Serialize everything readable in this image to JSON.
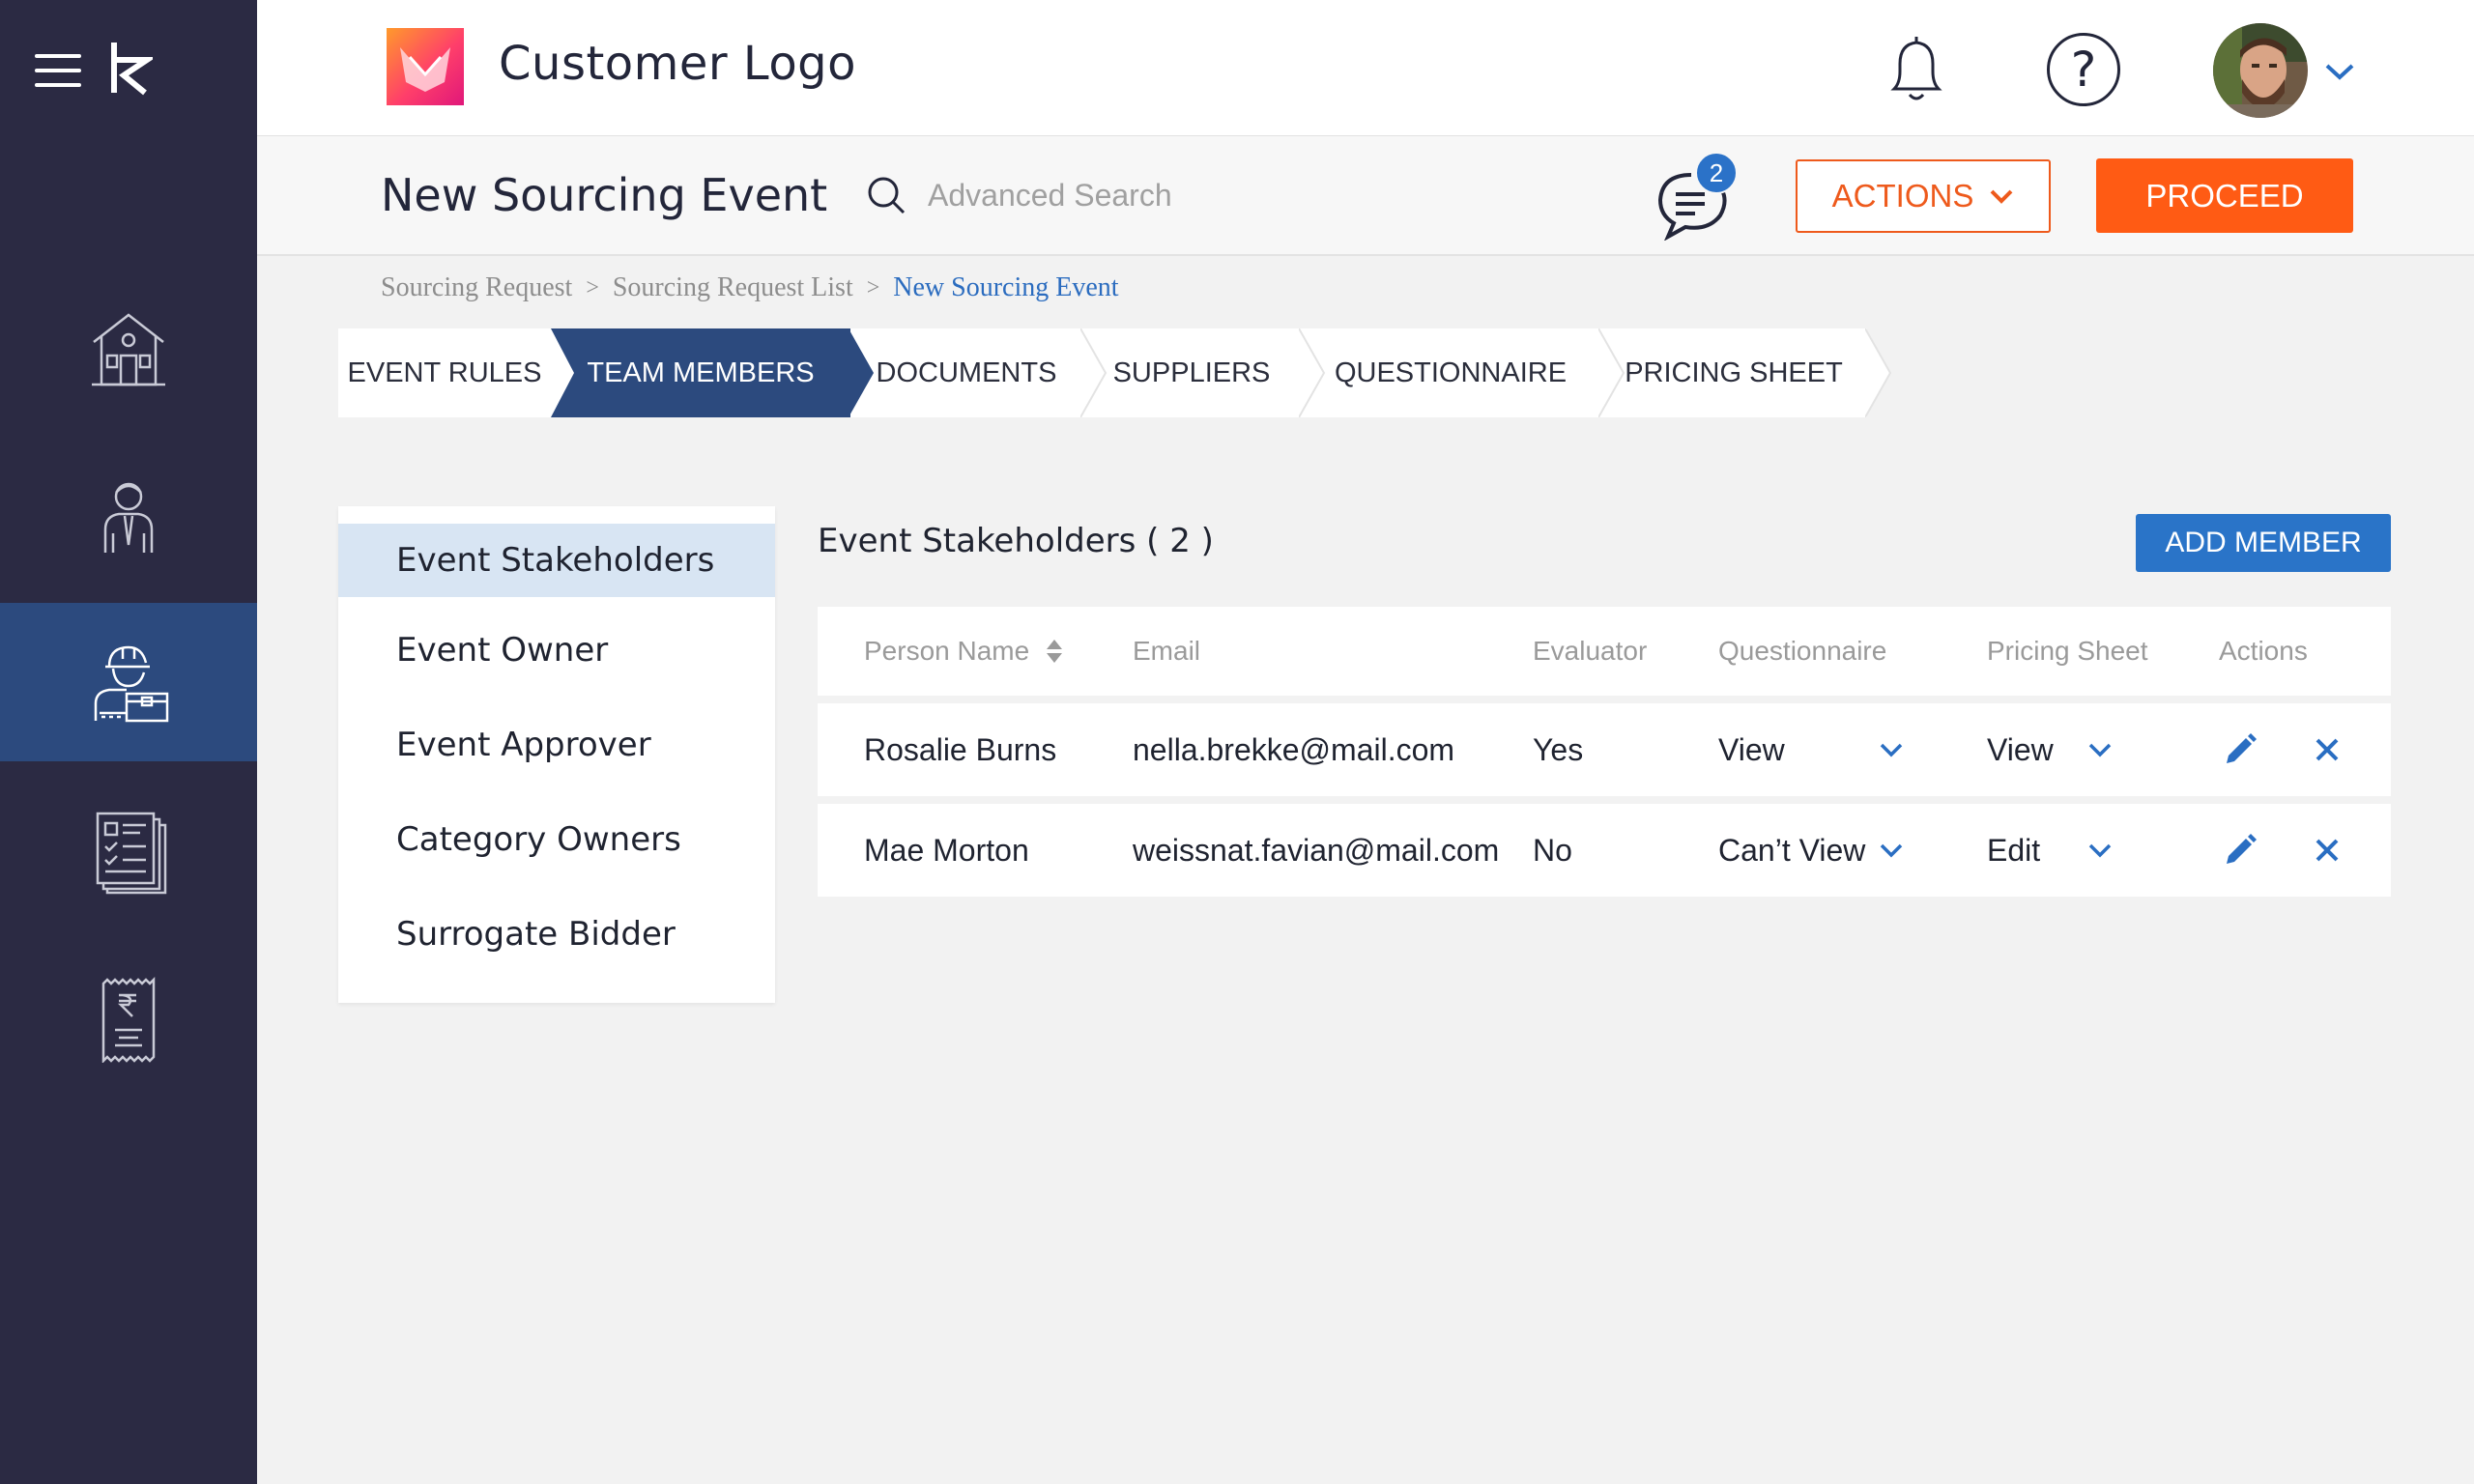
{
  "header": {
    "logo_text": "Customer Logo",
    "notifications_icon": "bell-icon",
    "help_icon": "help-icon",
    "help_glyph": "?",
    "user_menu_icon": "chevron-down-icon"
  },
  "rail": {
    "menu_icon": "hamburger-icon",
    "brand_icon": "brand-icon",
    "items": [
      {
        "icon": "home-icon",
        "active": false
      },
      {
        "icon": "employee-icon",
        "active": false
      },
      {
        "icon": "worker-icon",
        "active": true
      },
      {
        "icon": "checklist-document-icon",
        "active": false
      },
      {
        "icon": "rupee-receipt-icon",
        "active": false
      }
    ]
  },
  "subheader": {
    "title": "New Sourcing Event",
    "search_placeholder": "Advanced Search",
    "chat_badge": "2",
    "actions_label": "ACTIONS",
    "proceed_label": "PROCEED"
  },
  "breadcrumb": {
    "items": [
      "Sourcing Request",
      "Sourcing Request List",
      "New Sourcing Event"
    ],
    "separator": ">"
  },
  "stepper": {
    "steps": [
      "EVENT RULES",
      "TEAM MEMBERS",
      "DOCUMENTS",
      "SUPPLIERS",
      "QUESTIONNAIRE",
      "PRICING SHEET"
    ],
    "active_index": 1
  },
  "side_panel": {
    "items": [
      "Event Stakeholders",
      "Event Owner",
      "Event Approver",
      "Category Owners",
      "Surrogate Bidder"
    ],
    "active_index": 0
  },
  "section": {
    "title": "Event Stakeholders ( 2 )",
    "add_button": "ADD MEMBER"
  },
  "table": {
    "columns": [
      "Person Name",
      "Email",
      "Evaluator",
      "Questionnaire",
      "Pricing Sheet",
      "Actions"
    ],
    "rows": [
      {
        "name": "Rosalie Burns",
        "email": "nella.brekke@mail.com",
        "evaluator": "Yes",
        "questionnaire": "View",
        "pricing": "View"
      },
      {
        "name": "Mae Morton",
        "email": "weissnat.favian@mail.com",
        "evaluator": "No",
        "questionnaire": "Can’t View",
        "pricing": "Edit"
      }
    ]
  },
  "colors": {
    "rail_bg": "#2b2a43",
    "rail_active": "#2c4a7e",
    "accent_orange": "#ff5b14",
    "accent_blue": "#2a74c8",
    "step_active": "#2c4a7e",
    "side_active": "#d8e5f3"
  }
}
